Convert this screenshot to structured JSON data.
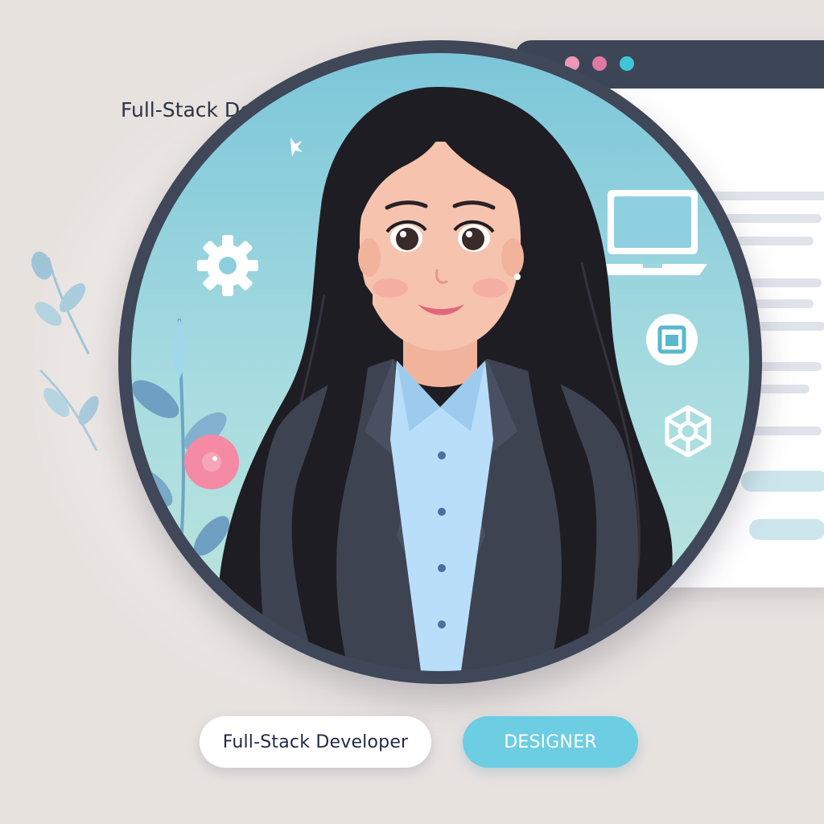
{
  "window": {
    "title": "Full-Stack Developer",
    "dots": [
      "#f29bbf",
      "#e07aa5",
      "#3ec6d8"
    ]
  },
  "profile": {
    "role_badge": "Full-Stack Developer",
    "secondary_badge": "DESIGNER"
  },
  "icons": [
    "gear-icon",
    "laptop-icon",
    "window-icon",
    "wheel-icon",
    "leaf-icon",
    "flower-icon"
  ],
  "colors": {
    "background": "#e8e2df",
    "ring": "#3f4758",
    "accent": "#6ccde3",
    "blazer": "#3e4352",
    "shirt": "#b9defa",
    "hair": "#1e1d24"
  }
}
